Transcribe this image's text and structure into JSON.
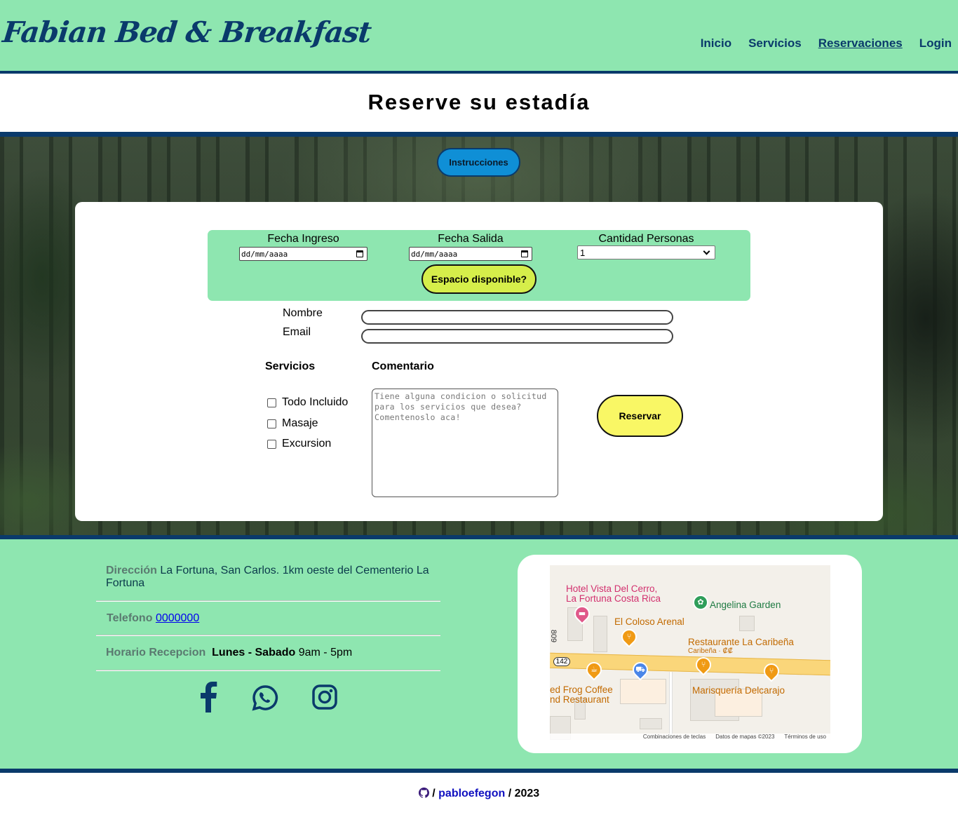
{
  "header": {
    "brand": "Fabian Bed & Breakfast",
    "nav": [
      "Inicio",
      "Servicios",
      "Reservaciones",
      "Login"
    ],
    "active_nav": "Reservaciones"
  },
  "page": {
    "title": "Reserve su estadía"
  },
  "instrucciones_button": "Instrucciones",
  "availability": {
    "check_in_label": "Fecha Ingreso",
    "check_in_value": "dd/mm/aaaa",
    "check_out_label": "Fecha Salida",
    "check_out_value": "dd/mm/aaaa",
    "guests_label": "Cantidad Personas",
    "guests_value": "1",
    "check_button": "Espacio disponible?"
  },
  "form": {
    "name_label": "Nombre",
    "email_label": "Email",
    "services_label": "Servicios",
    "services": [
      "Todo Incluido",
      "Masaje",
      "Excursion"
    ],
    "comment_label": "Comentario",
    "comment_placeholder": "Tiene alguna condicion o solicitud para los servicios que desea? Comentenoslo aca!",
    "submit": "Reservar"
  },
  "footer": {
    "address_key": "Dirección",
    "address_value": "La Fortuna, San Carlos. 1km oeste del Cementerio La Fortuna",
    "phone_key": "Telefono",
    "phone_value": "0000000",
    "hours_key": "Horario Recepcion",
    "hours_days": "Lunes - Sabado",
    "hours_time": "9am - 5pm",
    "social_icons": [
      "facebook-icon",
      "whatsapp-icon",
      "instagram-icon"
    ],
    "map": {
      "places": [
        "Hotel Vista Del Cerro,",
        "La Fortuna Costa Rica",
        "Angelina Garden",
        "El Coloso Arenal",
        "Restaurante La Caribeña",
        "Caribeña · ₡₡",
        "ed Frog Coffee",
        "nd Restaurant",
        "Marisquería Delcarajo"
      ],
      "road_shield": "142",
      "road_side": "809",
      "attribution": [
        "Combinaciones de teclas",
        "Datos de mapas ©2023",
        "Términos de uso"
      ]
    }
  },
  "credit": {
    "slash": "/",
    "user": "pabloefegon",
    "year": "2023"
  },
  "colors": {
    "mint": "#8ee6b0",
    "navy": "#0a3a6b",
    "yellow": "#f9f765",
    "lime": "#d6ee4a",
    "blue": "#0f8fd6"
  }
}
